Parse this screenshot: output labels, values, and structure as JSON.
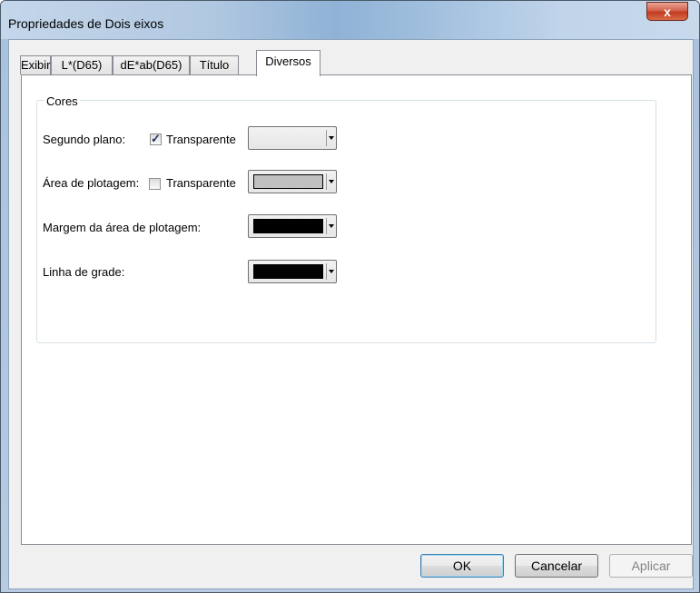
{
  "window": {
    "title": "Propriedades de Dois eixos",
    "close_label": "x"
  },
  "tabs": [
    {
      "label": "Exibir"
    },
    {
      "label": "L*(D65)"
    },
    {
      "label": "dE*ab(D65)"
    },
    {
      "label": "Título"
    },
    {
      "label": "Diversos",
      "active": true
    }
  ],
  "group": {
    "title": "Cores",
    "rows": {
      "background": {
        "label": "Segundo plano:",
        "checkbox_label": "Transparente",
        "checked": true,
        "color": "transparent"
      },
      "plot_area": {
        "label": "Área de plotagem:",
        "checkbox_label": "Transparente",
        "checked": false,
        "color": "#c0c0c0"
      },
      "plot_border": {
        "label": "Margem da área de plotagem:",
        "color": "#000000"
      },
      "grid_line": {
        "label": "Linha de grade:",
        "color": "#000000"
      }
    }
  },
  "buttons": {
    "ok": "OK",
    "cancel": "Cancelar",
    "apply": "Aplicar"
  }
}
